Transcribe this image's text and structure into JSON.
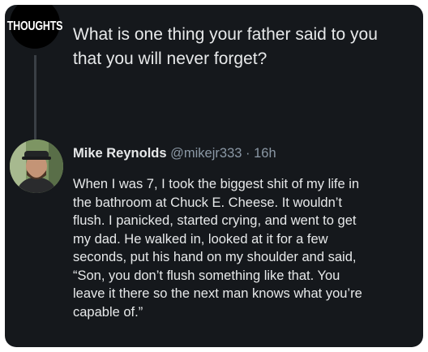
{
  "thoughts_badge": {
    "label": "THOUGHTS"
  },
  "question": {
    "lines": [
      "What is one thing your father said to you",
      "that you will never forget?"
    ]
  },
  "reply": {
    "author_name": "Mike Reynolds",
    "author_handle": "@mikejr333",
    "separator": "·",
    "timestamp": "16h",
    "body_lines": [
      "When I was 7, I took the biggest shit of my life in",
      "the bathroom at Chuck E. Cheese. It wouldn’t",
      "flush. I panicked, started crying, and went to get",
      "my dad. He walked in, looked at it for a few",
      "seconds, put his hand on my shoulder and said,",
      "“Son, you don’t flush something like that. You",
      "leave it there so the next man knows what you’re",
      "capable of.”"
    ]
  },
  "colors": {
    "background": "#15181c",
    "primary_text": "#e7e9ea",
    "secondary_text": "#8b98a5",
    "thread_line": "#3a3f45"
  }
}
